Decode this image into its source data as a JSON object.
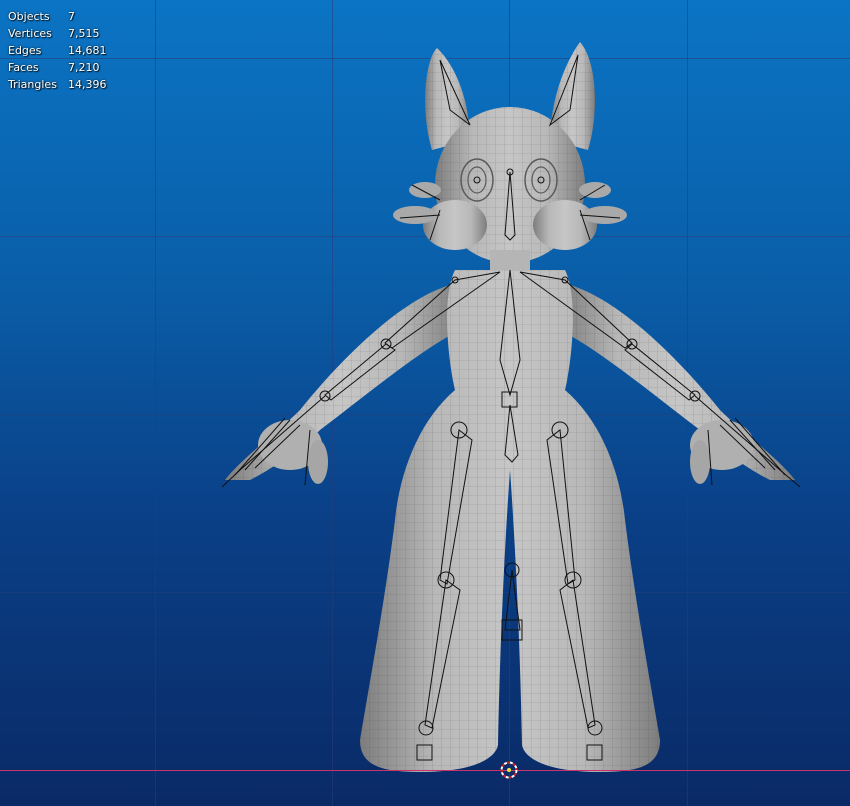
{
  "viewport": {
    "background_top": "#0b74c4",
    "background_bottom": "#0a2a66",
    "x_axis_color": "#c8336e"
  },
  "stats": [
    {
      "label": "Objects",
      "value": "7"
    },
    {
      "label": "Vertices",
      "value": "7,515"
    },
    {
      "label": "Edges",
      "value": "14,681"
    },
    {
      "label": "Faces",
      "value": "7,210"
    },
    {
      "label": "Triangles",
      "value": "14,396"
    }
  ],
  "icons": {
    "cursor": "3d-cursor-icon"
  }
}
